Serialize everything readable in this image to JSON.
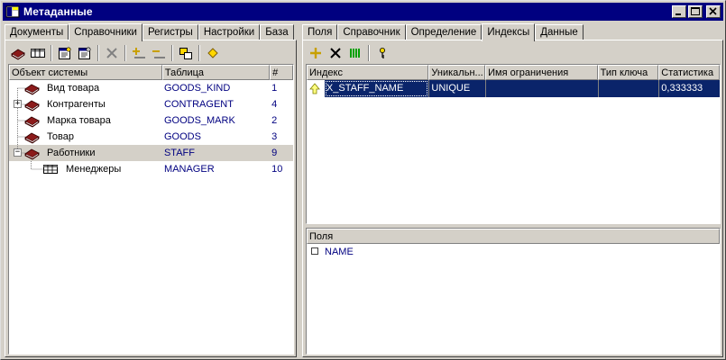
{
  "window": {
    "title": "Метаданные"
  },
  "left": {
    "tabs": [
      {
        "label": "Документы",
        "active": false
      },
      {
        "label": "Справочники",
        "active": true
      },
      {
        "label": "Регистры",
        "active": false
      },
      {
        "label": "Настройки",
        "active": false
      },
      {
        "label": "База",
        "active": false
      }
    ],
    "toolbar": [
      "book-icon",
      "table-icon",
      "properties-icon",
      "properties-alt-icon",
      "delete-icon",
      "add-field-icon",
      "remove-field-icon",
      "move-icon",
      "diamond-icon"
    ],
    "columns": [
      "Объект системы",
      "Таблица",
      "#"
    ],
    "rows": [
      {
        "name": "Вид товара",
        "table": "GOODS_KIND",
        "num": "1",
        "icon": "book-icon",
        "toggle": ""
      },
      {
        "name": "Контрагенты",
        "table": "CONTRAGENT",
        "num": "4",
        "icon": "book-icon",
        "toggle": "+"
      },
      {
        "name": "Марка товара",
        "table": "GOODS_MARK",
        "num": "2",
        "icon": "book-icon",
        "toggle": ""
      },
      {
        "name": "Товар",
        "table": "GOODS",
        "num": "3",
        "icon": "book-icon",
        "toggle": ""
      },
      {
        "name": "Работники",
        "table": "STAFF",
        "num": "9",
        "icon": "book-icon",
        "toggle": "-"
      },
      {
        "name": "Менеджеры",
        "table": "MANAGER",
        "num": "10",
        "icon": "table-icon",
        "toggle": ""
      }
    ]
  },
  "right": {
    "tabs": [
      {
        "label": "Поля",
        "active": false
      },
      {
        "label": "Справочник",
        "active": false
      },
      {
        "label": "Определение",
        "active": false
      },
      {
        "label": "Индексы",
        "active": true
      },
      {
        "label": "Данные",
        "active": false
      }
    ],
    "toolbar": [
      "add-icon",
      "delete-icon",
      "columns-icon",
      "key-icon"
    ],
    "index_columns": [
      "Индекс",
      "Уникальн...",
      "Имя ограничения",
      "Тип ключа",
      "Статистика"
    ],
    "index_rows": [
      {
        "name": "X_STAFF_NAME",
        "unique": "UNIQUE",
        "constraint": "",
        "key_type": "",
        "stats": "0,333333"
      }
    ],
    "fields_header": "Поля",
    "fields": [
      {
        "name": "NAME"
      }
    ]
  },
  "colors": {
    "title_bg": "#000080",
    "selection": "#0a246a",
    "table_text": "#000080",
    "book_red": "#8b1a1a"
  }
}
